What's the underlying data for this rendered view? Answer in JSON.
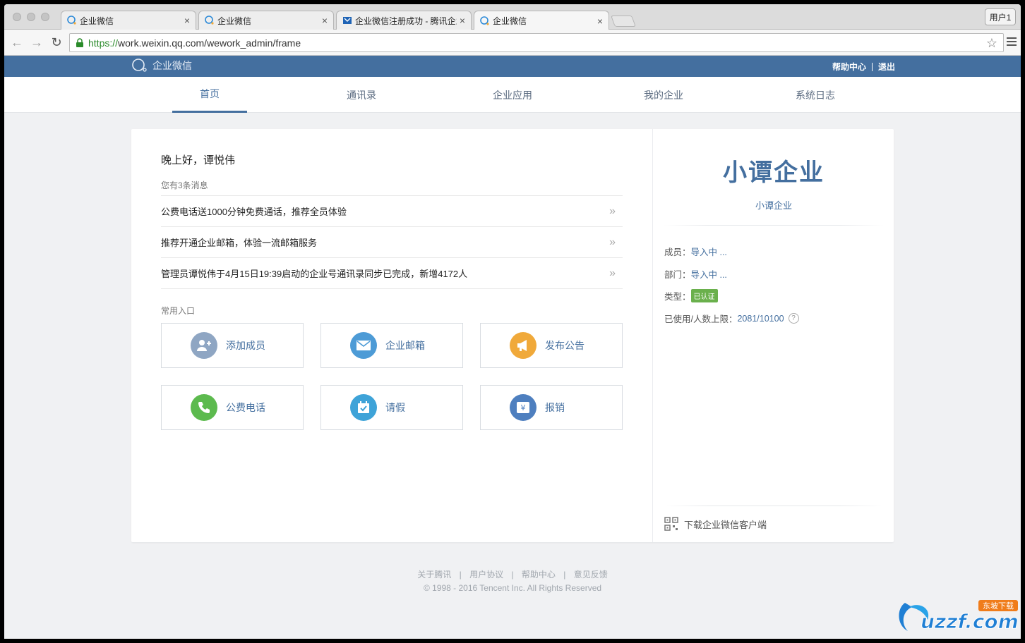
{
  "browser": {
    "tabs": [
      {
        "label": "企业微信",
        "icon": "wechat-work-icon"
      },
      {
        "label": "企业微信",
        "icon": "wechat-work-icon"
      },
      {
        "label": "企业微信注册成功 - 腾讯企业",
        "icon": "tencent-icon"
      },
      {
        "label": "企业微信",
        "icon": "wechat-work-icon"
      }
    ],
    "close_glyph": "×",
    "user_button": "用户1",
    "url_scheme": "https://",
    "url_rest": "work.weixin.qq.com/wework_admin/frame"
  },
  "header": {
    "logo_text": "企业微信",
    "help_link": "帮助中心",
    "logout_link": "退出"
  },
  "nav": {
    "items": [
      "首页",
      "通讯录",
      "企业应用",
      "我的企业",
      "系统日志"
    ],
    "active_index": 0
  },
  "main": {
    "greeting": "晚上好，谭悦伟",
    "message_count": "您有3条消息",
    "messages": [
      "公费电话送1000分钟免费通话，推荐全员体验",
      "推荐开通企业邮箱，体验一流邮箱服务",
      "管理员谭悦伟于4月15日19:39启动的企业号通讯录同步已完成，新增4172人"
    ],
    "arrow_glyph": "»",
    "common_title": "常用入口",
    "shortcuts": [
      {
        "label": "添加成员",
        "icon": "add-member-icon",
        "color": "#8fa6c3"
      },
      {
        "label": "企业邮箱",
        "icon": "mail-icon",
        "color": "#4d9bd6"
      },
      {
        "label": "发布公告",
        "icon": "megaphone-icon",
        "color": "#f0a93a"
      },
      {
        "label": "公费电话",
        "icon": "phone-icon",
        "color": "#5cba4e"
      },
      {
        "label": "请假",
        "icon": "calendar-icon",
        "color": "#3ea3d8"
      },
      {
        "label": "报销",
        "icon": "yen-icon",
        "color": "#4e7fbf"
      }
    ]
  },
  "corp": {
    "name": "小谭企业",
    "subname": "小谭企业",
    "members_label": "成员：",
    "members_value": "导入中 ...",
    "dept_label": "部门：",
    "dept_value": "导入中 ...",
    "type_label": "类型：",
    "type_badge": "已认证",
    "usage_label": "已使用/人数上限：",
    "usage_value": "2081/10100",
    "help_glyph": "?",
    "download_label": "下载企业微信客户端"
  },
  "footer": {
    "links": [
      "关于腾讯",
      "用户协议",
      "帮助中心",
      "意见反馈"
    ],
    "separator": "|",
    "copyright": "© 1998 - 2016 Tencent Inc. All Rights Reserved"
  },
  "watermark": {
    "text": "uzzf.com",
    "tag": "东坡下载"
  },
  "colors": {
    "brand": "#446f9f",
    "verified": "#6ab04c"
  }
}
